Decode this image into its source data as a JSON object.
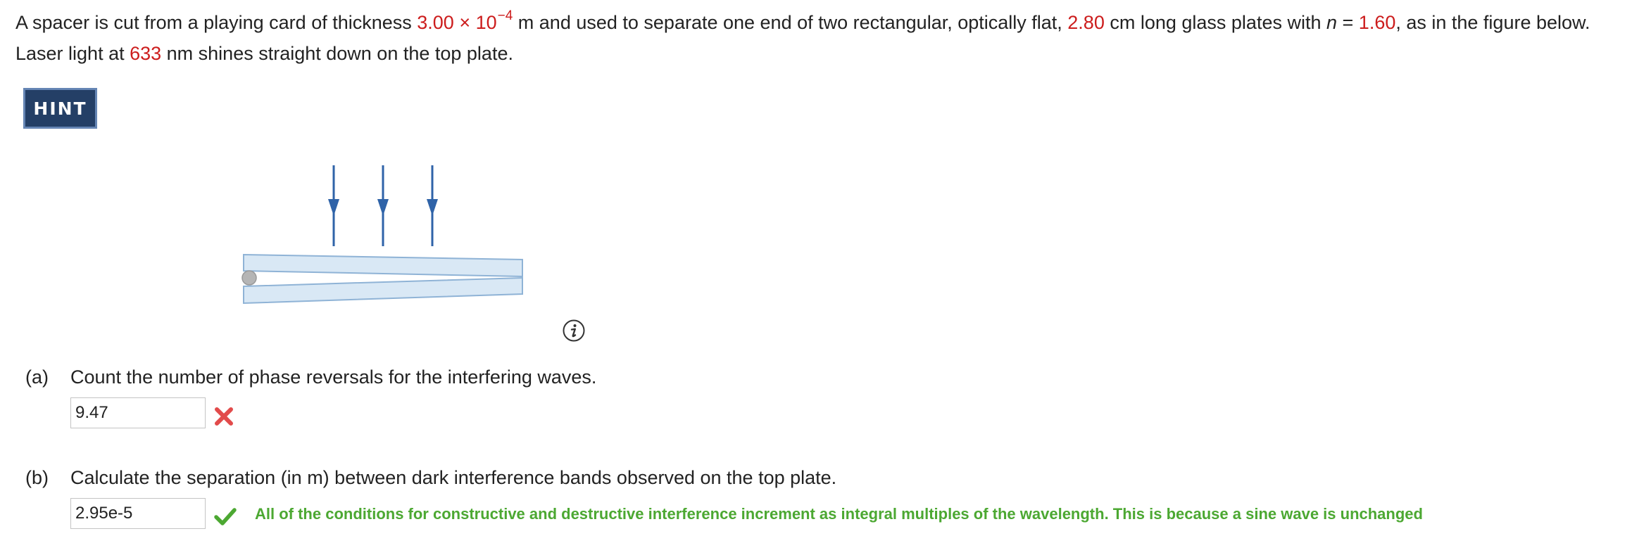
{
  "problem": {
    "text_1": "A spacer is cut from a playing card of thickness ",
    "thickness_value": "3.00 × 10",
    "thickness_exp": "−4",
    "text_2": " m and used to separate one end of two rectangular, optically flat, ",
    "length_value": "2.80",
    "text_3": " cm long glass plates with ",
    "n_symbol": "n",
    "text_4": " = ",
    "n_value": "1.60",
    "text_5": ", as in the figure below. Laser light at ",
    "wavelength_value": "633",
    "text_6": " nm shines straight down on the top plate."
  },
  "hint": {
    "label": "HINT"
  },
  "figure": {
    "icon": "info-icon",
    "arrow_color": "#2f63a8",
    "plate_color": "#d9e8f5",
    "plate_border": "#8fb3d6",
    "spacer_color": "#b5b5b5"
  },
  "part_a": {
    "label": "(a)",
    "question": "Count the number of phase reversals for the interfering waves.",
    "answer": "9.47",
    "status": "incorrect",
    "status_icon": "x-icon",
    "status_color": "#e24b4b"
  },
  "part_b": {
    "label": "(b)",
    "question": "Calculate the separation (in m) between dark interference bands observed on the top plate.",
    "answer": "2.95e-5",
    "status": "correct",
    "status_icon": "checkmark-icon",
    "status_color": "#4ca832",
    "feedback": "All of the conditions for constructive and destructive interference increment as integral multiples of the wavelength. This is because a sine wave is unchanged"
  }
}
